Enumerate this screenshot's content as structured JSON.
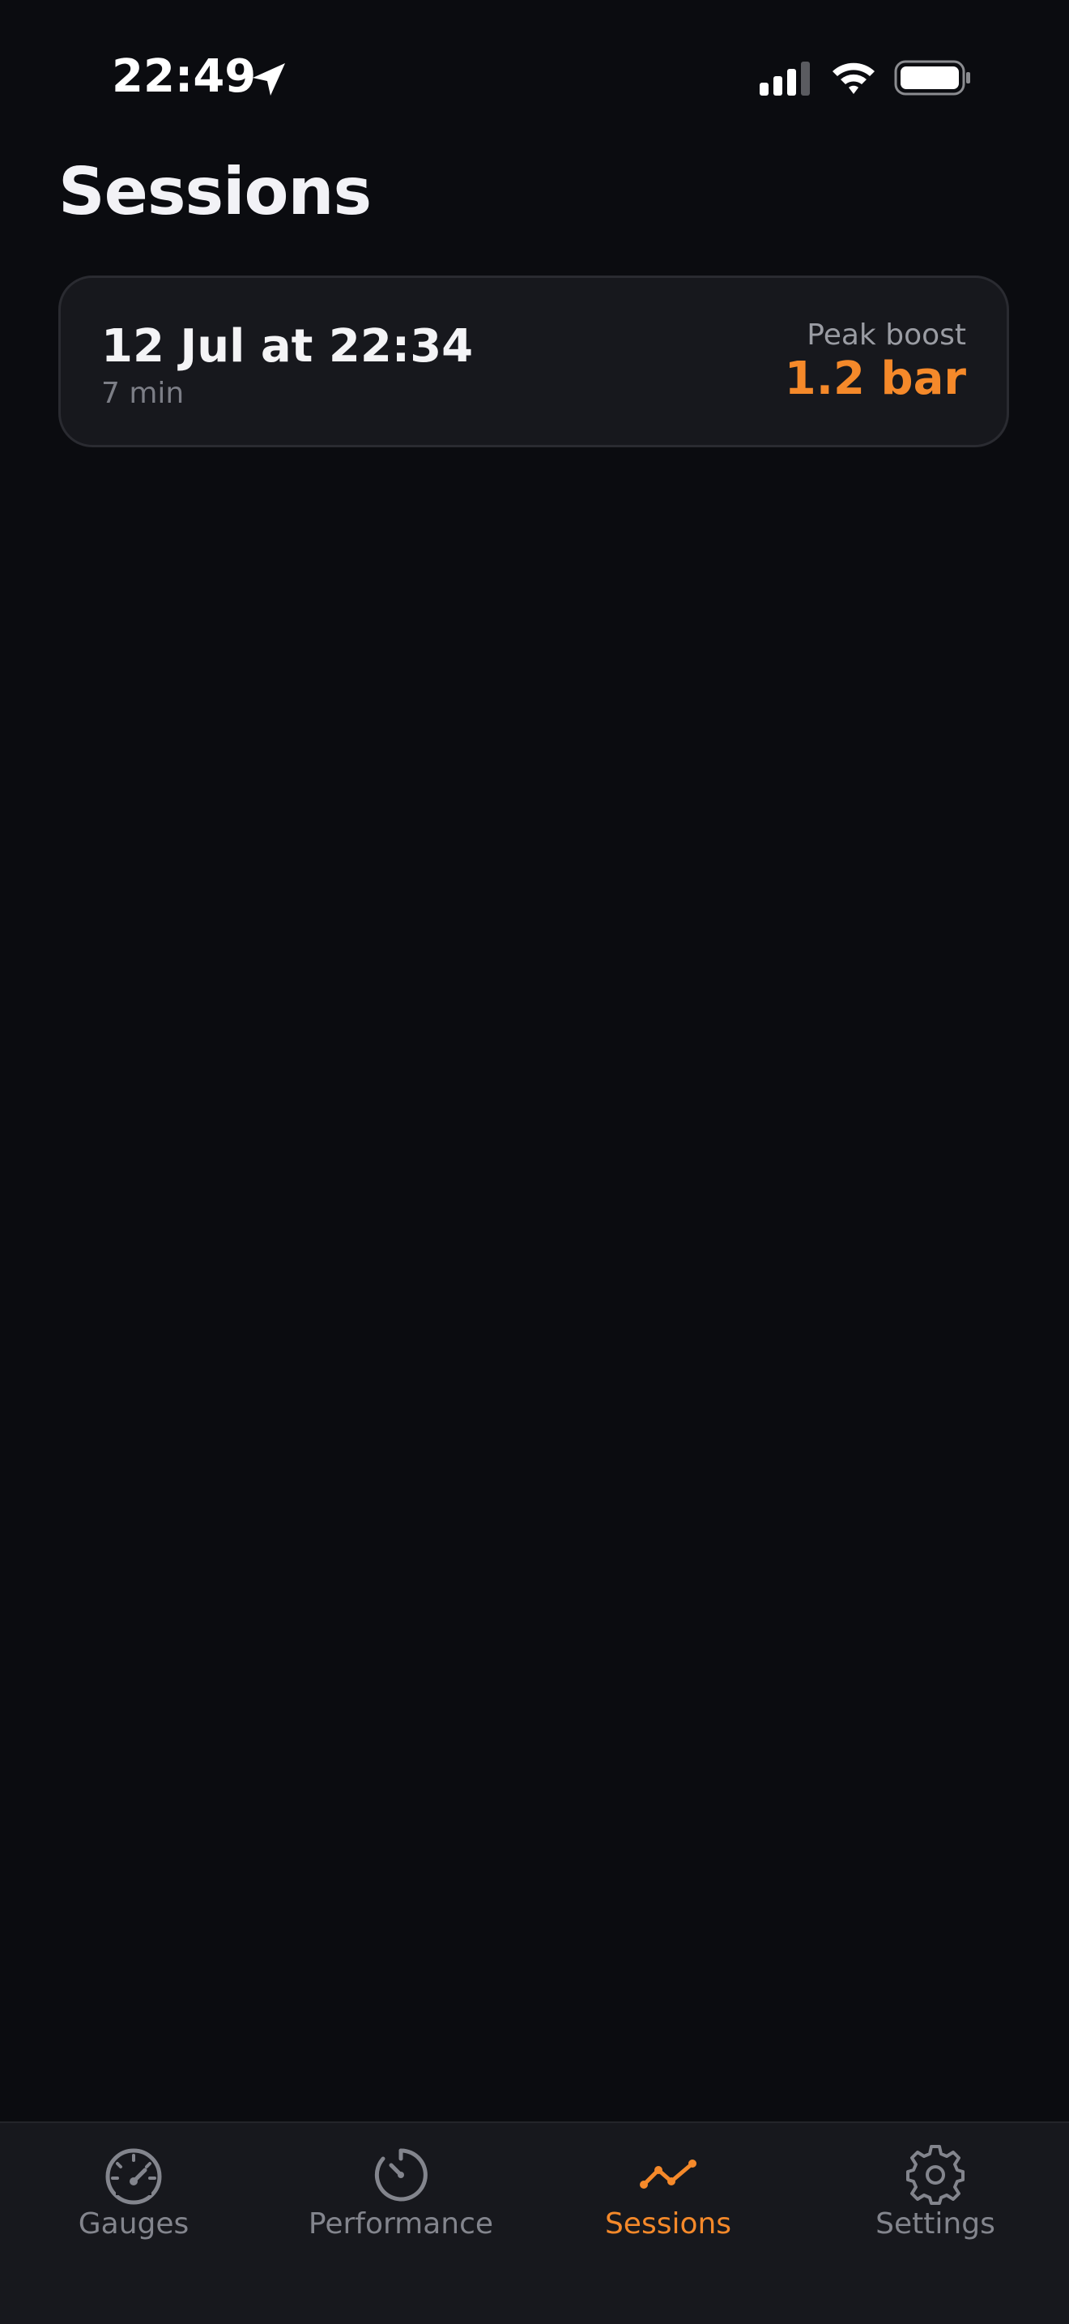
{
  "status_bar": {
    "time": "22:49",
    "location_icon": "location-arrow-icon",
    "signal_icon": "cellular-signal-icon",
    "wifi_icon": "wifi-icon",
    "battery_icon": "battery-icon"
  },
  "page": {
    "title": "Sessions"
  },
  "sessions": [
    {
      "date": "12 Jul at 22:34",
      "duration": "7 min",
      "peak_label": "Peak boost",
      "peak_value": "1.2 bar"
    }
  ],
  "tab_bar": {
    "tabs": [
      {
        "label": "Gauges",
        "icon": "gauge-icon",
        "active": false
      },
      {
        "label": "Performance",
        "icon": "stopwatch-icon",
        "active": false
      },
      {
        "label": "Sessions",
        "icon": "line-chart-icon",
        "active": true
      },
      {
        "label": "Settings",
        "icon": "gear-icon",
        "active": false
      }
    ]
  },
  "colors": {
    "accent": "#f5892a",
    "background": "#0b0c10",
    "card": "#17181d",
    "muted_text": "#83858d"
  }
}
